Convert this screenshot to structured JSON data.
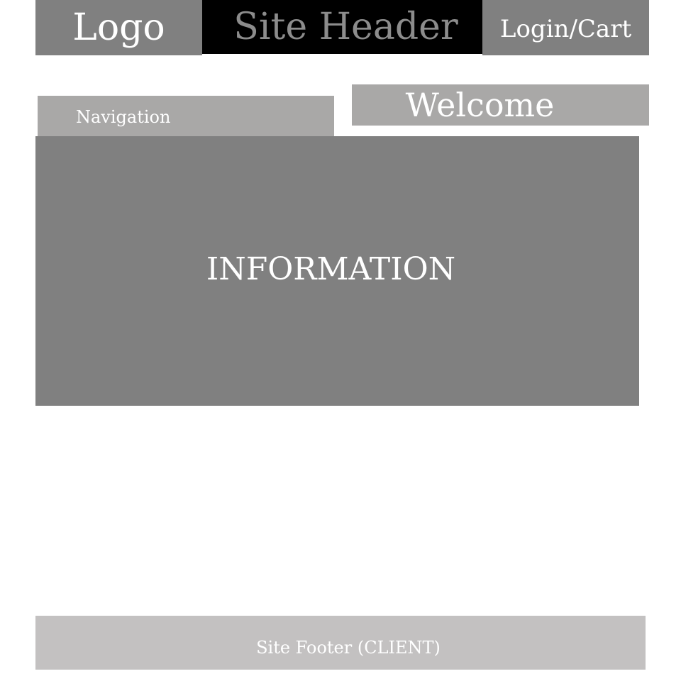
{
  "header": {
    "logo": "Logo",
    "title": "Site Header",
    "login_cart": "Login/Cart"
  },
  "navigation": {
    "label": "Navigation"
  },
  "welcome": {
    "label": "Welcome"
  },
  "main": {
    "information": "INFORMATION"
  },
  "footer": {
    "label": "Site Footer (CLIENT)"
  },
  "colors": {
    "dark_gray": "#808080",
    "mid_gray": "#a9a8a7",
    "light_gray": "#c3c1c1",
    "header_black": "#000000",
    "header_text": "#8c8c8c",
    "text_white": "#ffffff"
  }
}
